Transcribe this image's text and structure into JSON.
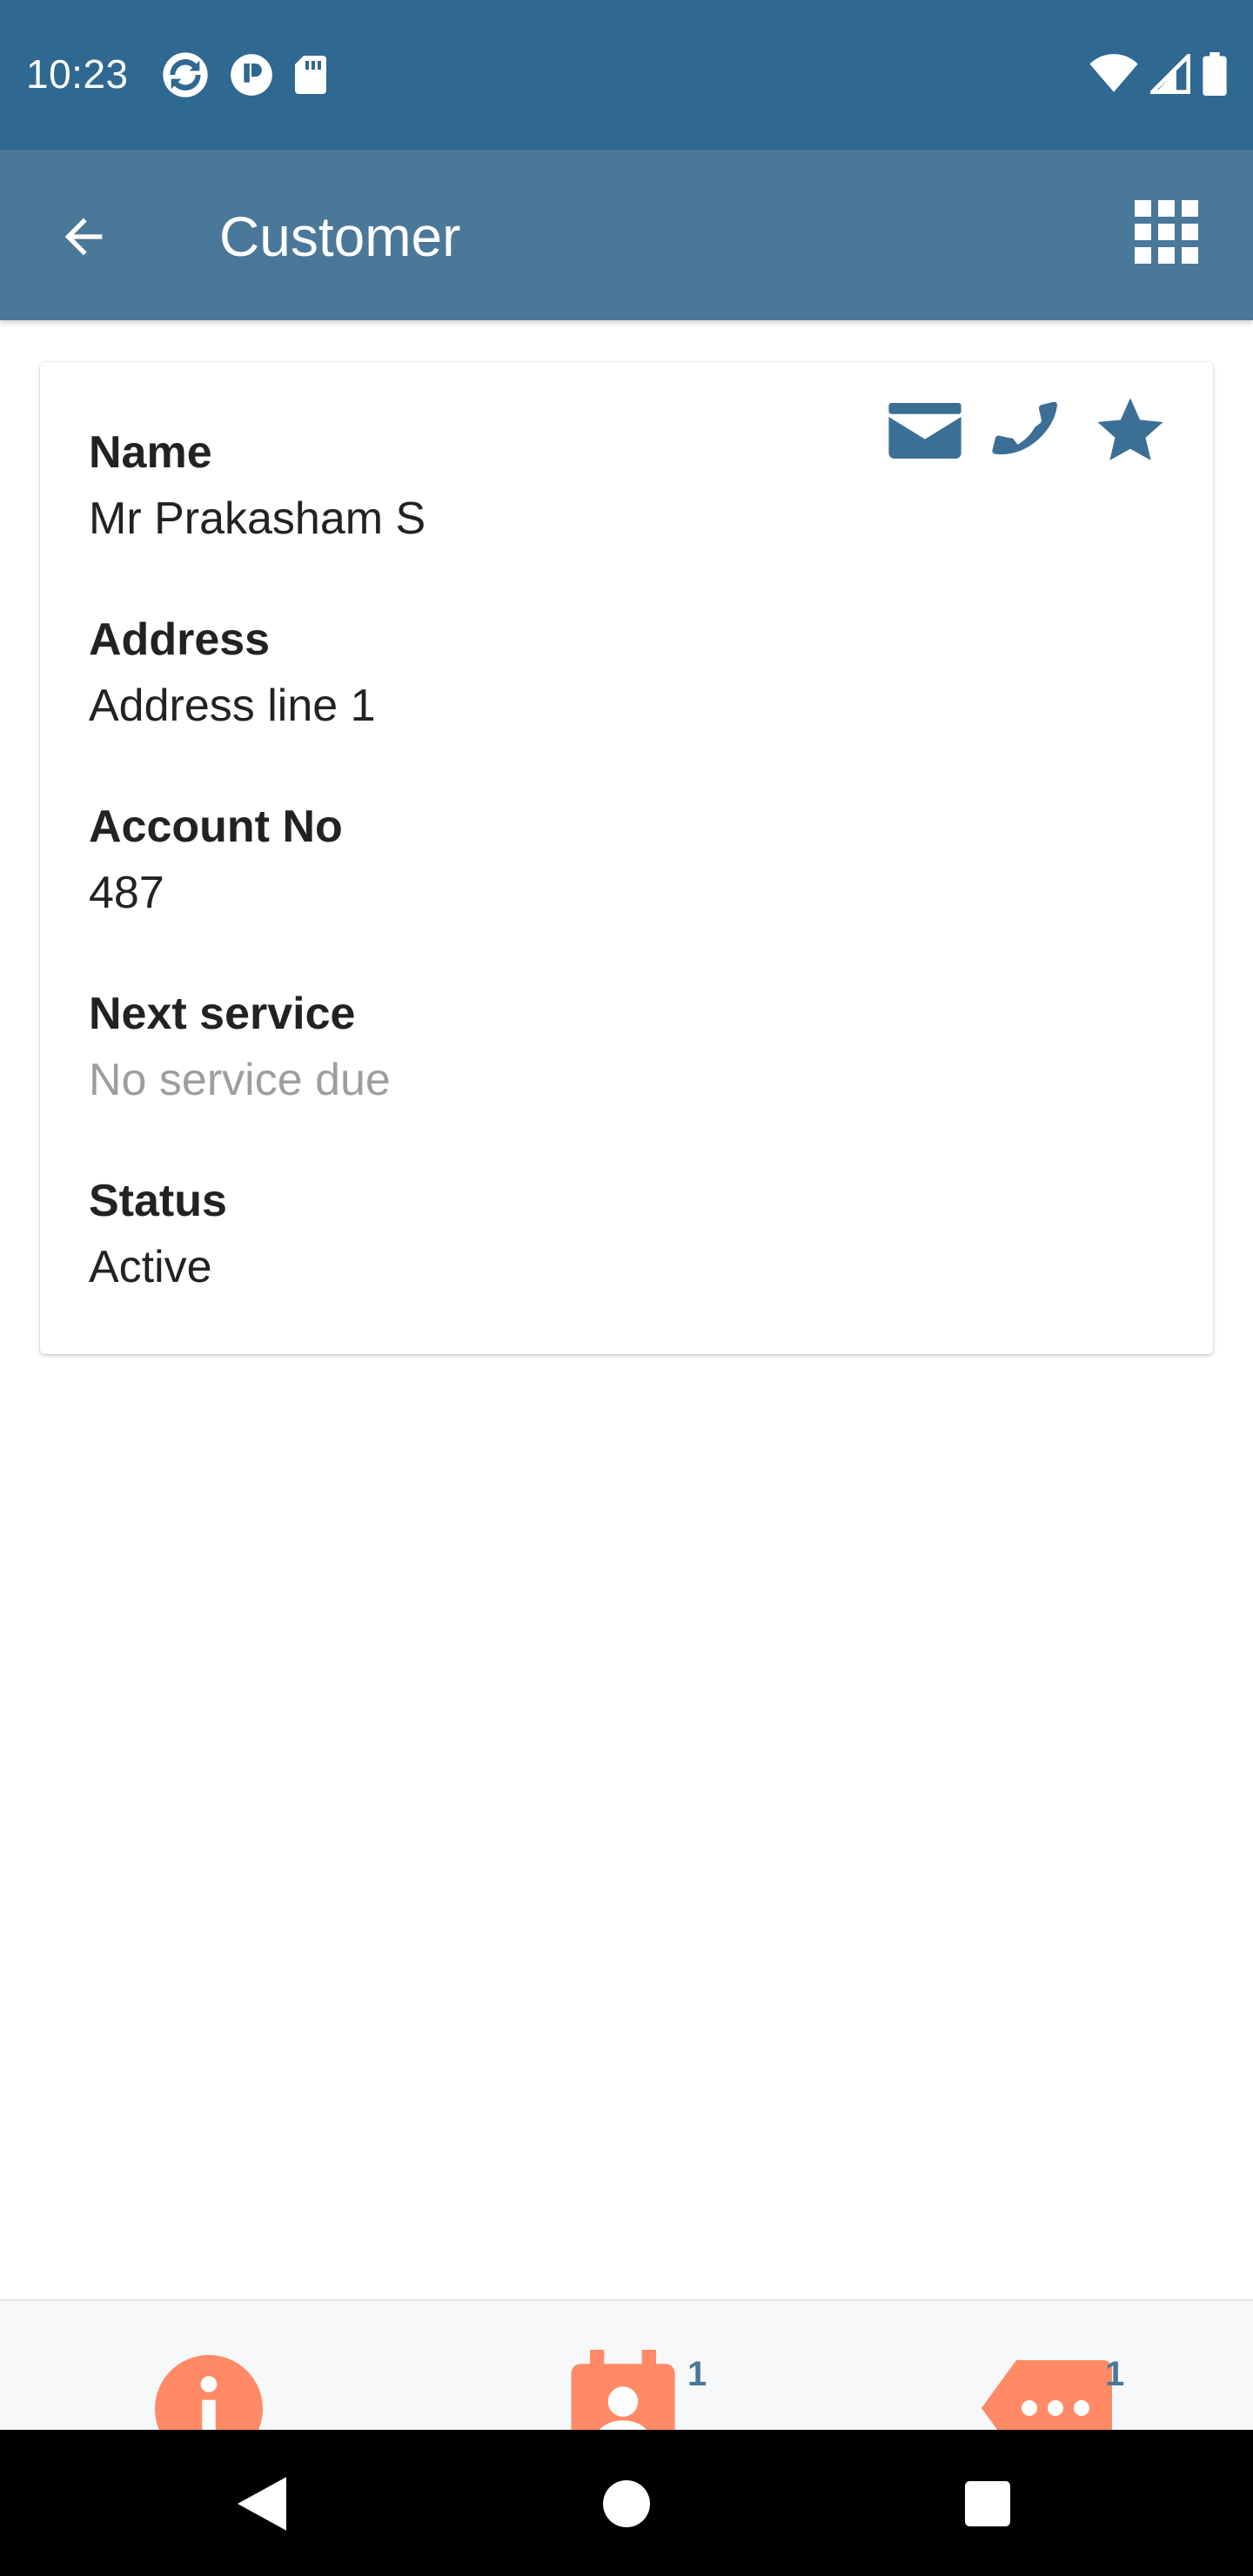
{
  "status_bar": {
    "time": "10:23",
    "left_icons": [
      "sync-icon",
      "app-notification-icon",
      "sd-card-icon"
    ],
    "right_icons": [
      "wifi-icon",
      "cell-signal-icon",
      "battery-icon"
    ]
  },
  "app_bar": {
    "title": "Customer",
    "back_icon": "arrow-left-icon",
    "menu_icon": "grid-menu-icon"
  },
  "card": {
    "actions": [
      "email-icon",
      "phone-icon",
      "star-icon"
    ],
    "fields": [
      {
        "label": "Name",
        "value": "Mr Prakasham S"
      },
      {
        "label": "Address",
        "value": "Address line 1"
      },
      {
        "label": "Account No",
        "value": "487"
      },
      {
        "label": "Next service",
        "value": "No service due"
      },
      {
        "label": "Status",
        "value": "Active"
      }
    ]
  },
  "bottom_tabs": [
    {
      "name": "info",
      "icon": "info-icon",
      "badge": ""
    },
    {
      "name": "appointments",
      "icon": "calendar-person-icon",
      "badge": "1"
    },
    {
      "name": "messages",
      "icon": "message-tag-icon",
      "badge": "1"
    }
  ],
  "colors": {
    "status_bar": "#2f6890",
    "app_bar": "#4a7899",
    "accent_icon": "#3c6f95",
    "tab_icon": "#ff8a65",
    "muted_text": "#9e9e9e"
  },
  "nav_bar": [
    "back-triangle-icon",
    "home-circle-icon",
    "recents-square-icon"
  ]
}
